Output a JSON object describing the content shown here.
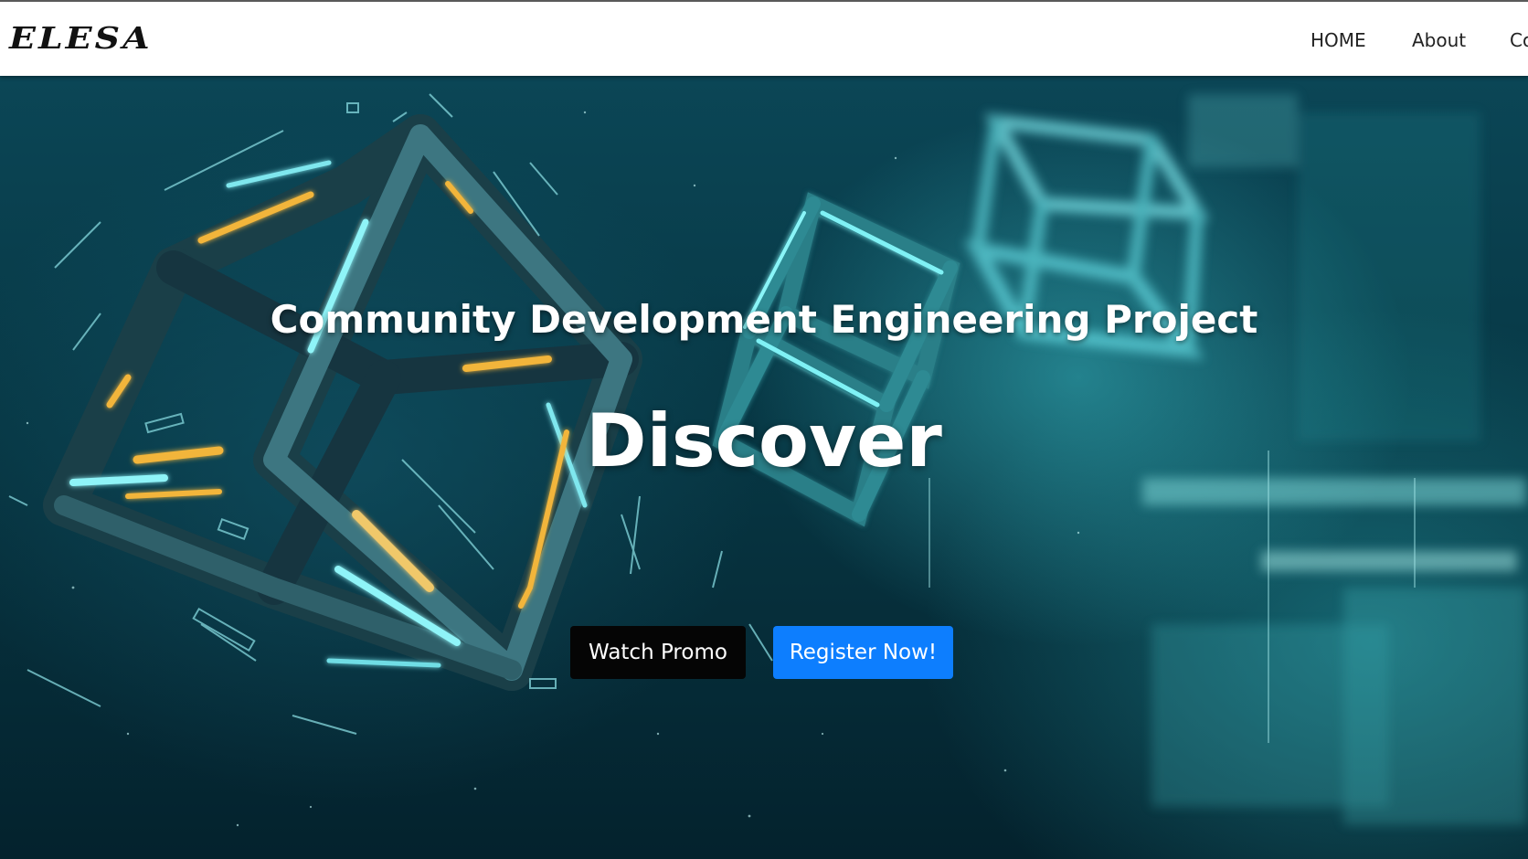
{
  "navbar": {
    "brand": "ELESA",
    "links": [
      "HOME",
      "About",
      "Co"
    ]
  },
  "hero": {
    "title": "Community Development Engineering Project",
    "heading": "Discover",
    "buttons": {
      "promo": "Watch Promo",
      "register": "Register Now!"
    },
    "colors": {
      "promo_button": "#050505",
      "register_button": "#0d7efe",
      "background": "#073744",
      "accent_glow": "#5ee8f0",
      "accent_amber": "#f2b53a"
    }
  }
}
